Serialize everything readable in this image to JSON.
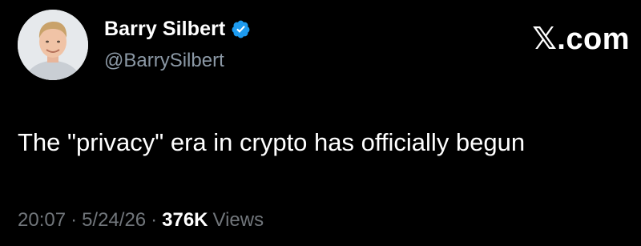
{
  "author": {
    "display_name": "Barry Silbert",
    "handle": "@BarrySilbert",
    "verified": true
  },
  "brand": "𝕏.com",
  "tweet": {
    "text": "The \"privacy\" era in crypto has officially begun"
  },
  "meta": {
    "time": "20:07",
    "date": "5/24/26",
    "separator": "·",
    "views_count": "376K",
    "views_label": "Views"
  },
  "colors": {
    "background": "#000000",
    "text": "#ffffff",
    "muted": "#71767b",
    "verified": "#1d9bf0"
  },
  "icons": {
    "verified": "verified-badge-icon",
    "avatar": "profile-avatar"
  }
}
